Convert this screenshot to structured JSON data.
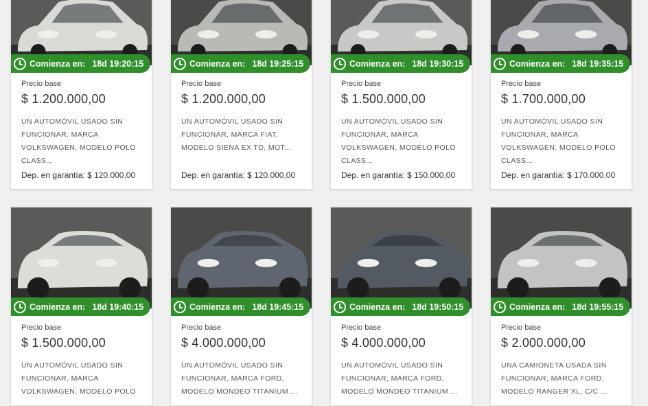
{
  "colors": {
    "timer_bg": "#2f8f2a",
    "card_bg": "#ffffff",
    "page_bg": "#f0f0f0"
  },
  "cards": [
    {
      "timer_label": "Comienza en:",
      "timer": "18d 19:20:15",
      "base_label": "Precio base",
      "price": "$ 1.200.000,00",
      "description": "UN AUTOMÓVIL USADO SIN FUNCIONAR. MARCA VOLKSWAGEN, MODELO POLO CLASS...",
      "deposit_label": "Dep. en garantía:",
      "deposit": "$ 120.000,00",
      "car_color": "#d9d9d6"
    },
    {
      "timer_label": "Comienza en:",
      "timer": "18d 19:25:15",
      "base_label": "Precio base",
      "price": "$ 1.200.000,00",
      "description": "UN AUTOMÓVIL USADO SIN FUNCIONAR, MARCA FIAT, MODELO SIENA EX TD, MOT...",
      "deposit_label": "Dep. en garantía:",
      "deposit": "$ 120.000,00",
      "car_color": "#b9b9b6"
    },
    {
      "timer_label": "Comienza en:",
      "timer": "18d 19:30:15",
      "base_label": "Precio base",
      "price": "$ 1.500.000,00",
      "description": "UN AUTOMÓVIL USADO SIN FUNCIONAR, MARCA VOLKSWAGEN, MODELO POLO CLASS...",
      "deposit_label": "Dep. en garantía:",
      "deposit": "$ 150.000,00",
      "car_color": "#c8c8c6"
    },
    {
      "timer_label": "Comienza en:",
      "timer": "18d 19:35:15",
      "base_label": "Precio base",
      "price": "$ 1.700.000,00",
      "description": "UN AUTOMÓVIL USADO SIN FUNCIONAR, MARCA VOLKSWAGEN, MODELO POLO CLASS...",
      "deposit_label": "Dep. en garantía:",
      "deposit": "$ 170.000,00",
      "car_color": "#a9aaae"
    },
    {
      "timer_label": "Comienza en:",
      "timer": "18d 19:40:15",
      "base_label": "Precio base",
      "price": "$ 1.500.000,00",
      "description": "UN AUTOMÓVIL USADO SIN FUNCIONAR, MARCA VOLKSWAGEN, MODELO POLO",
      "deposit_label": "",
      "deposit": "",
      "car_color": "#dcdcd8"
    },
    {
      "timer_label": "Comienza en:",
      "timer": "18d 19:45:15",
      "base_label": "Precio base",
      "price": "$ 4.000.000,00",
      "description": "UN AUTOMÓVIL USADO SIN FUNCIONAR, MARCA FORD, MODELO MONDEO TITANIUM ...",
      "deposit_label": "",
      "deposit": "",
      "car_color": "#5f6670"
    },
    {
      "timer_label": "Comienza en:",
      "timer": "18d 19:50:15",
      "base_label": "Precio base",
      "price": "$ 4.000.000,00",
      "description": "UN AUTOMÓVIL USADO SIN FUNCIONAR, MARCA FORD, MODELO MONDEO TITANIUM ...",
      "deposit_label": "",
      "deposit": "",
      "car_color": "#545a62"
    },
    {
      "timer_label": "Comienza en:",
      "timer": "18d 19:55:15",
      "base_label": "Precio base",
      "price": "$ 2.000.000,00",
      "description": "UNA CAMIONETA USADA SIN FUNCIONAR, MARCA FORD, MODELO RANGER XL, C/C ...",
      "deposit_label": "",
      "deposit": "",
      "car_color": "#c2c3c2"
    }
  ]
}
